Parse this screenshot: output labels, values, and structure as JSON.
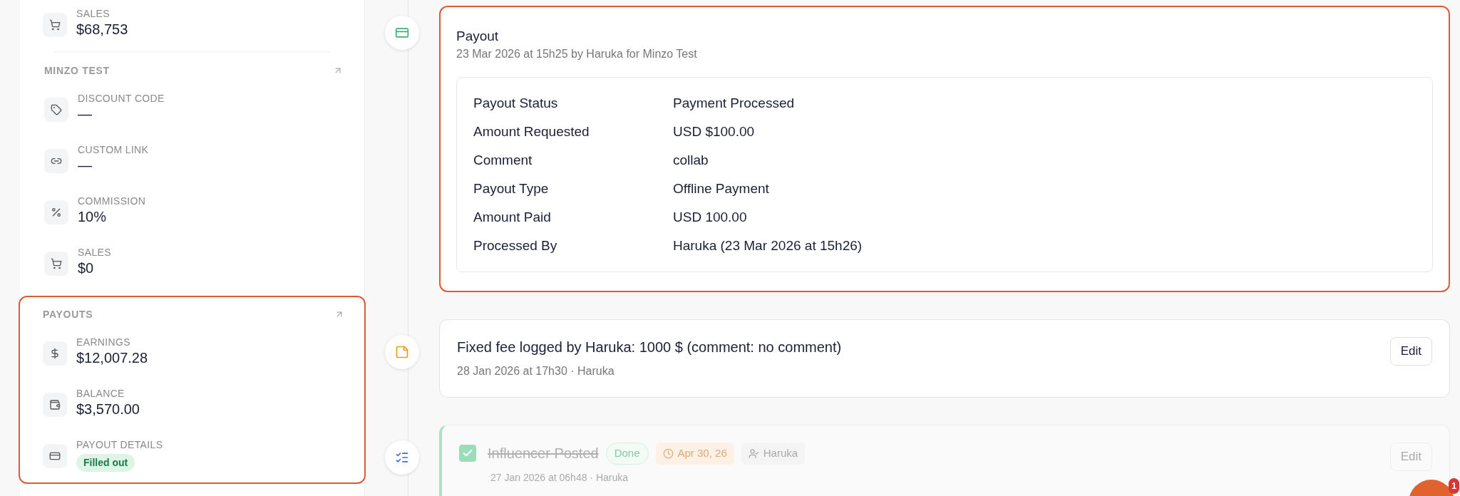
{
  "sidebar": {
    "top_items": [
      {
        "kind": "sales",
        "label": "SALES",
        "value": "$68,753"
      }
    ],
    "sections": [
      {
        "title": "MINZO TEST",
        "highlighted": false,
        "items": [
          {
            "kind": "code",
            "label": "DISCOUNT CODE",
            "value": "—"
          },
          {
            "kind": "link",
            "label": "CUSTOM LINK",
            "value": "—"
          },
          {
            "kind": "commission",
            "label": "COMMISSION",
            "value": "10%"
          },
          {
            "kind": "sales",
            "label": "SALES",
            "value": "$0"
          }
        ]
      },
      {
        "title": "PAYOUTS",
        "highlighted": true,
        "items": [
          {
            "kind": "earnings",
            "label": "EARNINGS",
            "value": "$12,007.28"
          },
          {
            "kind": "balance",
            "label": "BALANCE",
            "value": "$3,570.00"
          },
          {
            "kind": "details",
            "label": "PAYOUT DETAILS",
            "badge": "Filled out"
          }
        ]
      }
    ]
  },
  "timeline": [
    {
      "kind": "payout",
      "highlighted": true,
      "title": "Payout",
      "meta": "23 Mar 2026 at 15h25 by Haruka for Minzo Test",
      "details": [
        {
          "label": "Payout Status",
          "value": "Payment Processed"
        },
        {
          "label": "Amount Requested",
          "value": "USD $100.00"
        },
        {
          "label": "Comment",
          "value": "collab"
        },
        {
          "label": "Payout Type",
          "value": "Offline Payment"
        },
        {
          "label": "Amount Paid",
          "value": "USD 100.00"
        },
        {
          "label": "Processed By",
          "value": "Haruka (23 Mar 2026 at 15h26)"
        }
      ]
    },
    {
      "kind": "fee",
      "highlighted": false,
      "title": "Fixed fee logged by Haruka: 1000 $ (comment: no comment)",
      "meta": "28 Jan 2026 at 17h30 · Haruka",
      "button": "Edit",
      "disabled": false
    },
    {
      "kind": "task",
      "highlighted": false,
      "title": "Influencer Posted",
      "checked": true,
      "status": "Done",
      "due": "Apr 30, 26",
      "assignee": "Haruka",
      "meta": "27 Jan 2026 at 06h48 · Haruka",
      "button": "Edit",
      "disabled": true
    }
  ],
  "chat": {
    "badge": "1"
  }
}
